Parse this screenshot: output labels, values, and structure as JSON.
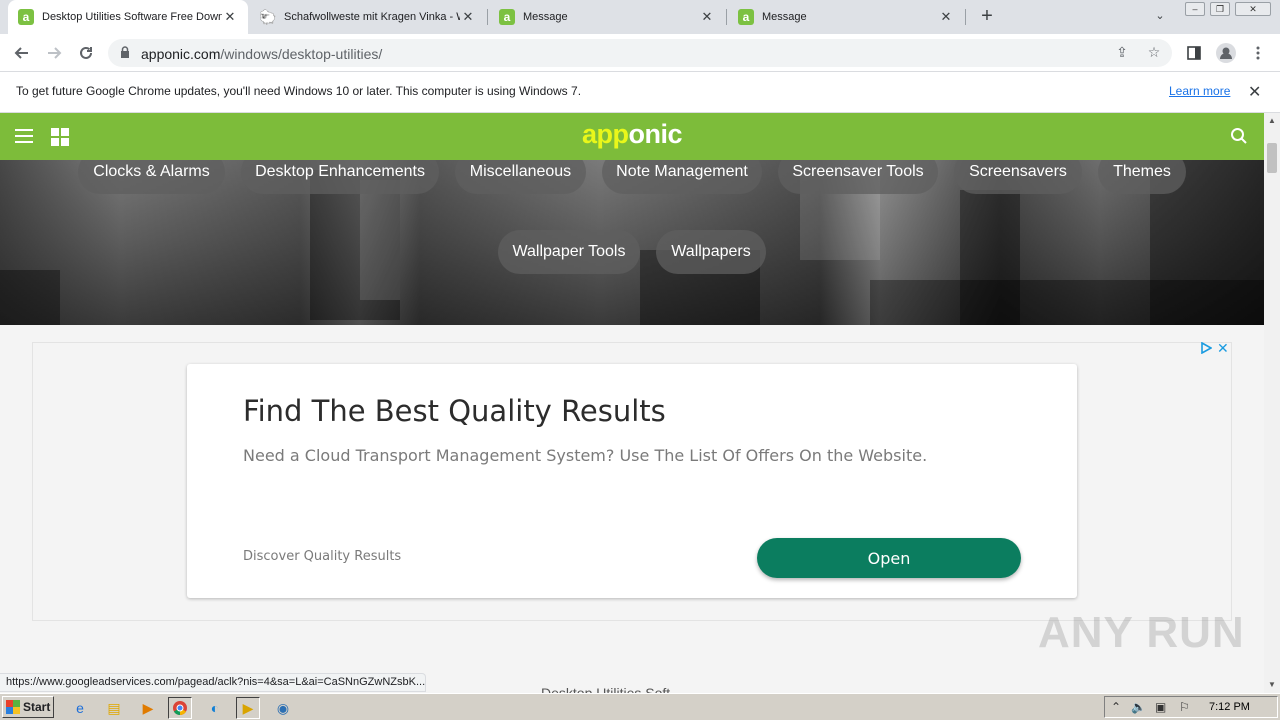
{
  "browser": {
    "tabs": [
      {
        "title": "Desktop Utilities Software Free Down",
        "favicon": "apponic-icon",
        "active": true
      },
      {
        "title": "Schafwollweste mit Kragen Vinka - W",
        "favicon": "sheep-icon",
        "active": false
      },
      {
        "title": "Message",
        "favicon": "apponic-icon",
        "active": false
      },
      {
        "title": "Message",
        "favicon": "apponic-icon",
        "active": false
      }
    ],
    "url_host": "apponic.com",
    "url_path": "/windows/desktop-utilities/"
  },
  "infobar": {
    "message": "To get future Google Chrome updates, you'll need Windows 10 or later. This computer is using Windows 7.",
    "learn_more": "Learn more"
  },
  "site": {
    "logo_part1": "app",
    "logo_part2": "onic",
    "colors": {
      "header": "#7dbc3a",
      "logo_accent": "#e9f71a",
      "cta": "#0b7d5f"
    },
    "categories": [
      "Clocks & Alarms",
      "Desktop Enhancements",
      "Miscellaneous",
      "Note Management",
      "Screensaver Tools",
      "Screensavers",
      "Themes",
      "Wallpaper Tools",
      "Wallpapers"
    ],
    "footer_peek": "Desktop Utilities Soft..."
  },
  "ad": {
    "title": "Find The Best Quality Results",
    "description": "Need a Cloud Transport Management System? Use The List Of Offers On the Website.",
    "disclaimer": "Discover Quality Results",
    "button": "Open"
  },
  "status_url": "https://www.googleadservices.com/pagead/aclk?nis=4&sa=L&ai=CaSNnGZwNZsbK...",
  "watermark": "ANY RUN",
  "taskbar": {
    "start": "Start",
    "clock": "7:12 PM"
  }
}
